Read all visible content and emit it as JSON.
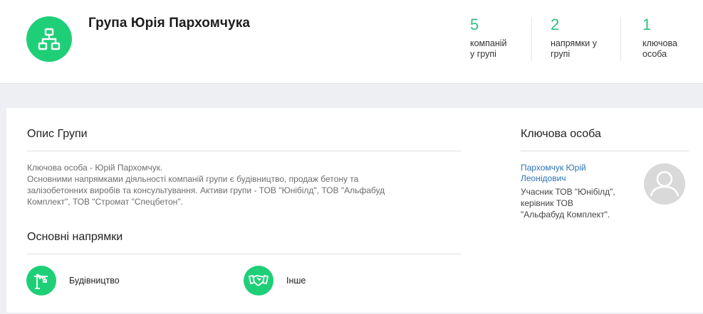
{
  "header": {
    "title": "Група Юрія Пархомчука",
    "logo_icon": "org-structure-icon",
    "stats": [
      {
        "value": "5",
        "label_line1": "компаній",
        "label_line2": "у групі"
      },
      {
        "value": "2",
        "label_line1": "напрямки у",
        "label_line2": "групі"
      },
      {
        "value": "1",
        "label_line1": "ключова",
        "label_line2": "особа"
      }
    ]
  },
  "description": {
    "title": "Опис Групи",
    "lines": [
      "Ключова особа - Юрій Пархомчук.",
      "Основними напрямками діяльності компаній групи є будівництво, продаж бетону та",
      "залізобетонних виробів та консультування. Активи групи - ТОВ \"Юнібілд\", ТОВ \"Альфабуд",
      "Комплект\", ТОВ \"Стромат \"Спецбетон\"."
    ]
  },
  "directions": {
    "title": "Основні напрямки",
    "items": [
      {
        "label": "Будівництво",
        "icon": "crane-icon"
      },
      {
        "label": "Інше",
        "icon": "handshake-icon"
      }
    ]
  },
  "key_person": {
    "title": "Ключова особа",
    "name_line1": "Пархомчук Юрій",
    "name_line2": "Леонідович",
    "role_lines": [
      "Учасник ТОВ \"Юнібілд\",",
      "керівник ТОВ",
      "\"Альфабуд Комплект\"."
    ],
    "avatar_icon": "user-avatar-icon"
  },
  "colors": {
    "accent_green": "#1fcf78",
    "stat_green": "#2ec27e",
    "link_blue": "#2b74b8",
    "background": "#eeeff3"
  }
}
